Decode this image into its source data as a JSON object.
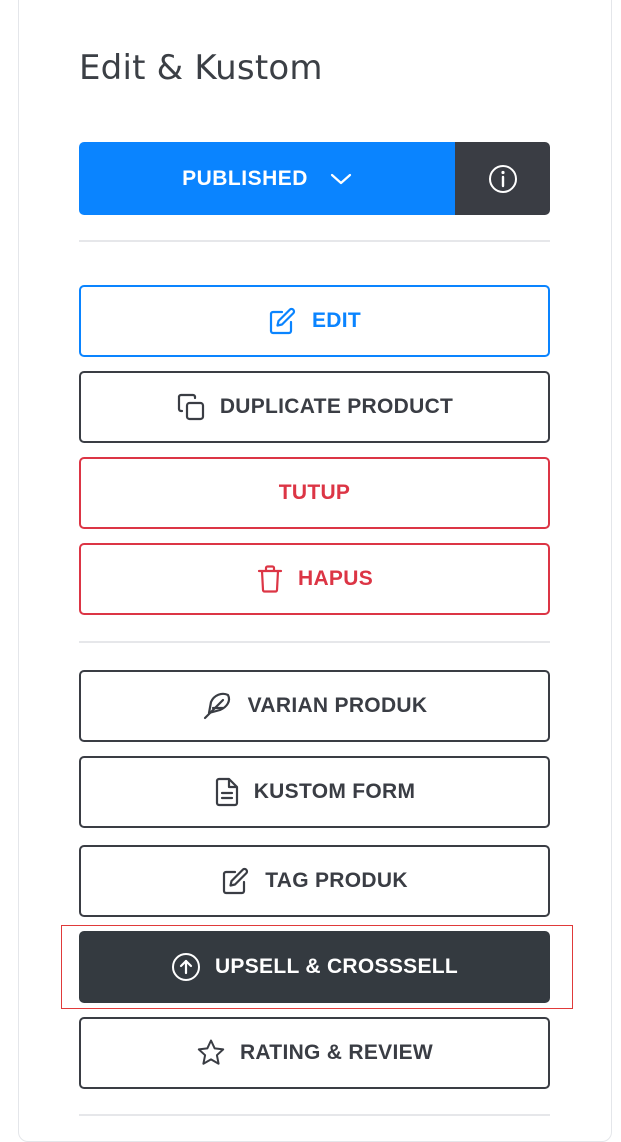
{
  "panel": {
    "title": "Edit & Kustom"
  },
  "status": {
    "label": "PUBLISHED",
    "dropdown_icon": "chevron-down-icon",
    "info_icon": "info-circle-icon"
  },
  "actions_primary": [
    {
      "label": "EDIT",
      "icon": "edit-icon",
      "variant": "primary"
    },
    {
      "label": "DUPLICATE PRODUCT",
      "icon": "copy-icon",
      "variant": "dark-outline"
    },
    {
      "label": "TUTUP",
      "icon": "",
      "variant": "danger"
    },
    {
      "label": "HAPUS",
      "icon": "trash-icon",
      "variant": "danger"
    }
  ],
  "actions_secondary": [
    {
      "label": "VARIAN PRODUK",
      "icon": "feather-icon",
      "variant": "dark-outline"
    },
    {
      "label": "KUSTOM FORM",
      "icon": "file-text-icon",
      "variant": "dark-outline"
    },
    {
      "label": "TAG PRODUK",
      "icon": "edit-icon",
      "variant": "dark-outline"
    },
    {
      "label": "UPSELL & CROSSSELL",
      "icon": "arrow-up-circle-icon",
      "variant": "dark-filled",
      "highlighted": true
    },
    {
      "label": "RATING & REVIEW",
      "icon": "star-icon",
      "variant": "dark-outline"
    }
  ],
  "colors": {
    "primary": "#0a84ff",
    "danger": "#dc3545",
    "dark": "#343a40",
    "highlight_border": "#e03a3a"
  }
}
